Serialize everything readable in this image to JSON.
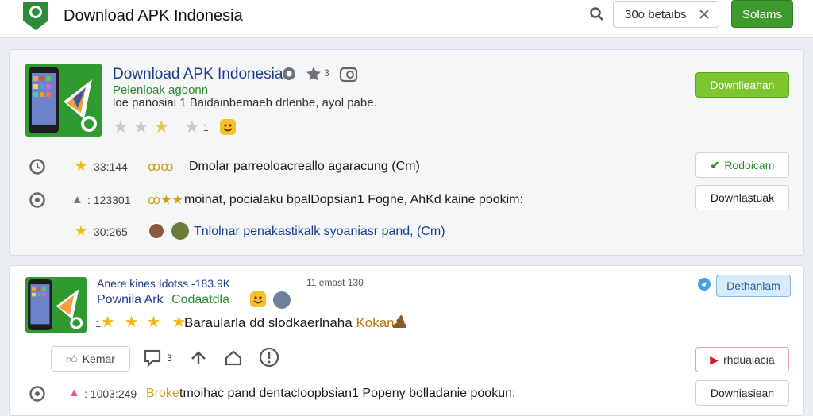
{
  "header": {
    "title": "Download APK Indonesia",
    "search_value": "30o betaibs",
    "button_label": "Solams"
  },
  "card1": {
    "app_name": "Download APK Indonesia",
    "rating_small": "3",
    "subtitle": "Pelenloak agoonn",
    "description": "loe panosiai 1 Baidainbemaeh drlenbe, ayol pabe.",
    "stars_count": "1",
    "download_button": "Downlleahan",
    "rows": [
      {
        "stat": "33:144",
        "text": "Dmolar parreoloacreallo agaracung (Cm)",
        "button": "Rodoicam"
      },
      {
        "stat": "123301",
        "text": "moinat, pocialaku bpalDopsian1 Fogne, AhKd kaine pookim:",
        "button": "Downlastuak"
      },
      {
        "stat": "30:265",
        "text": "Tnlolnar penakastikalk syoaniasr pand, (Cm)",
        "button": ""
      }
    ]
  },
  "card2": {
    "app_name": "Anere kines Idotss -183.9K",
    "time": "11 emast 130",
    "subtitle_blue": "Pownila Ark",
    "subtitle_green": "Codaatdla",
    "star_prefix": "1",
    "description": "Baraularla dd slodkaerlnaha",
    "description_highlight": "Kokan",
    "blue_button": "Dethanlam",
    "like_label": "Kemar",
    "comment_count": "3",
    "red_button": "rhduaiacia",
    "row": {
      "stat": "1003:249",
      "highlight": "Broke",
      "text": "tmoihac pand dentacloopbsian1 Popeny bolladanie pookun:",
      "button": "Downiasiean"
    }
  },
  "colors": {
    "brand_green": "#3e9a2c",
    "link_blue": "#1c3d8f",
    "star": "#f0b90b"
  }
}
